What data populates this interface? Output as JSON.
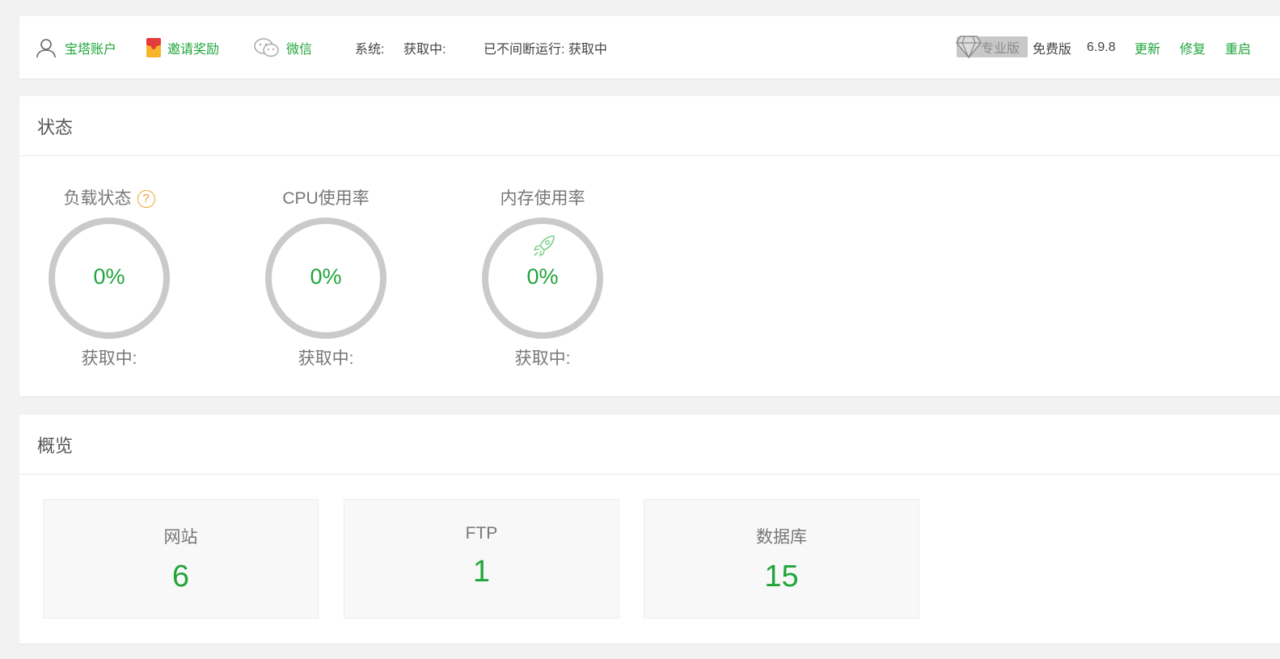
{
  "topbar": {
    "account": "宝塔账户",
    "invite": "邀请奖励",
    "wechat": "微信",
    "system_label": "系统:",
    "system_value": "获取中:",
    "uptime": "已不间断运行: 获取中",
    "pro_label": "专业版",
    "free_label": "免费版",
    "version": "6.9.8",
    "update": "更新",
    "repair": "修复",
    "restart": "重启"
  },
  "status": {
    "title": "状态",
    "gauges": [
      {
        "title": "负载状态",
        "value": "0%",
        "sub": "获取中:",
        "level": 0
      },
      {
        "title": "CPU使用率",
        "value": "0%",
        "sub": "获取中:",
        "level": 0
      },
      {
        "title": "内存使用率",
        "value": "0%",
        "sub": "获取中:",
        "level": 0
      }
    ],
    "help_glyph": "?"
  },
  "overview": {
    "title": "概览",
    "boxes": [
      {
        "label": "网站",
        "value": "6"
      },
      {
        "label": "FTP",
        "value": "1"
      },
      {
        "label": "数据库",
        "value": "15"
      }
    ]
  },
  "colors": {
    "accent": "#20a53a",
    "ring": "#cacaca",
    "help": "#f0a32e"
  },
  "icons": {
    "account": "user-icon",
    "invite": "red-envelope-icon",
    "wechat": "wechat-icon",
    "pro": "diamond-icon",
    "memory": "rocket-icon"
  }
}
